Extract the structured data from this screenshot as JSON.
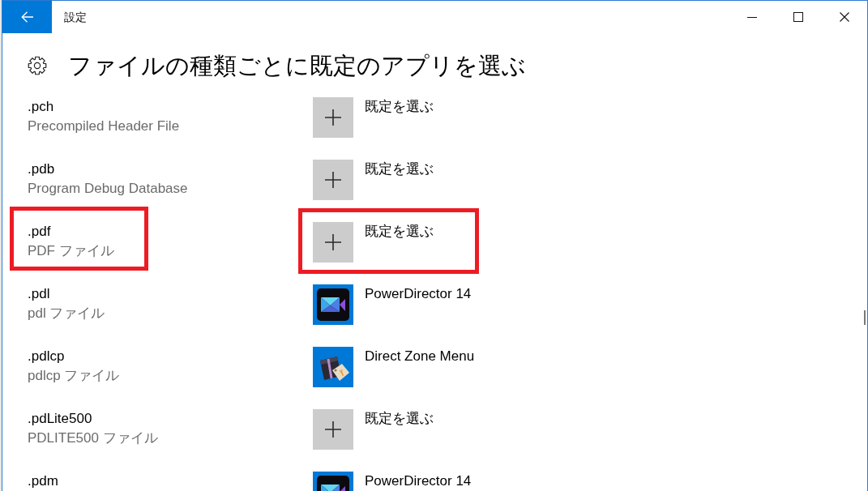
{
  "window": {
    "title": "設定"
  },
  "page": {
    "title": "ファイルの種類ごとに既定のアプリを選ぶ"
  },
  "rows": [
    {
      "extension": ".pch",
      "description": "Precompiled Header File",
      "app": {
        "kind": "choose",
        "label": "既定を選ぶ"
      },
      "highlighted": false
    },
    {
      "extension": ".pdb",
      "description": "Program Debug Database",
      "app": {
        "kind": "choose",
        "label": "既定を選ぶ"
      },
      "highlighted": false
    },
    {
      "extension": ".pdf",
      "description": "PDF ファイル",
      "app": {
        "kind": "choose",
        "label": "既定を選ぶ"
      },
      "highlighted": true
    },
    {
      "extension": ".pdl",
      "description": "pdl ファイル",
      "app": {
        "kind": "video",
        "label": "PowerDirector 14"
      },
      "highlighted": false
    },
    {
      "extension": ".pdlcp",
      "description": "pdlcp ファイル",
      "app": {
        "kind": "gift",
        "label": "Direct Zone Menu"
      },
      "highlighted": false
    },
    {
      "extension": ".pdLite500",
      "description": "PDLITE500 ファイル",
      "app": {
        "kind": "choose",
        "label": "既定を選ぶ"
      },
      "highlighted": false
    },
    {
      "extension": ".pdm",
      "app": {
        "kind": "video",
        "label": "PowerDirector 14"
      },
      "highlighted": false
    }
  ]
}
